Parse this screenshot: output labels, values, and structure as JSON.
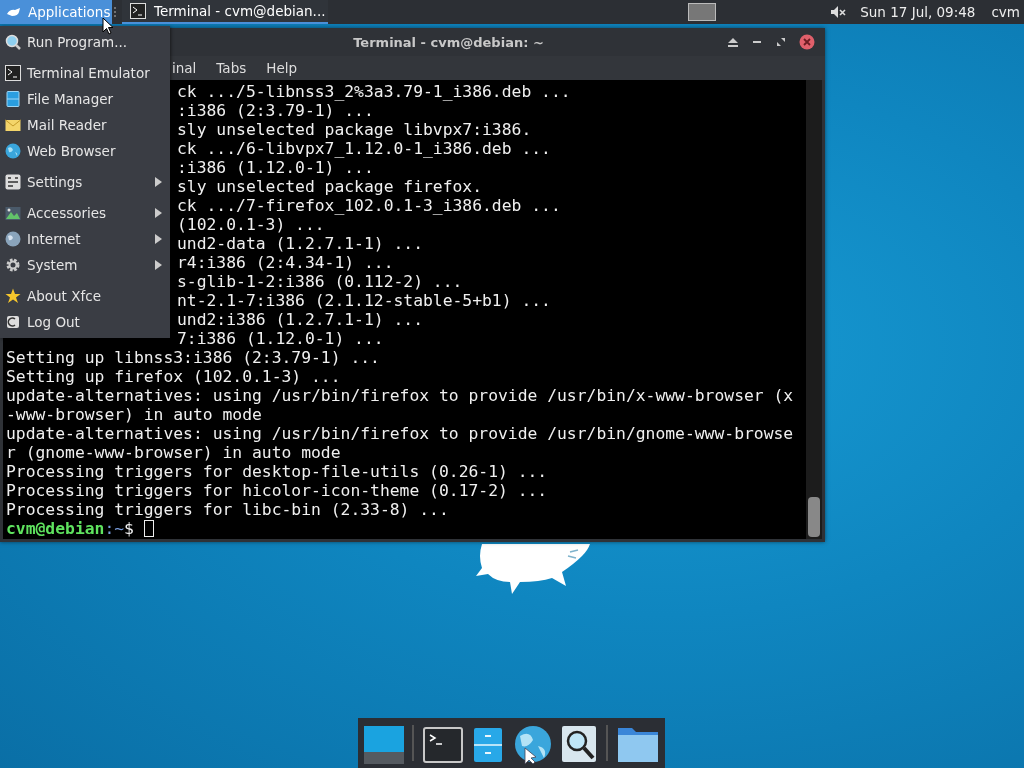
{
  "top_panel": {
    "applications_button": {
      "label": "Applications",
      "selected": true
    },
    "tasks": [
      {
        "title": "Terminal - cvm@debian...",
        "selected": true
      }
    ],
    "muted": true,
    "clock": "Sun 17 Jul, 09:48",
    "user": "cvm"
  },
  "terminal": {
    "title": "Terminal - cvm@debian: ~",
    "menu": [
      "inal",
      "Tabs",
      "Help"
    ],
    "partial_lines": [
      "ck .../5-libnss3_2%3a3.79-1_i386.deb ...",
      ":i386 (2:3.79-1) ...",
      "sly unselected package libvpx7:i386.",
      "ck .../6-libvpx7_1.12.0-1_i386.deb ...",
      ":i386 (1.12.0-1) ...",
      "sly unselected package firefox.",
      "ck .../7-firefox_102.0.1-3_i386.deb ...",
      "(102.0.1-3) ...",
      "und2-data (1.2.7.1-1) ...",
      "r4:i386 (2:4.34-1) ...",
      "s-glib-1-2:i386 (0.112-2) ...",
      "nt-2.1-7:i386 (2.1.12-stable-5+b1) ...",
      "und2:i386 (1.2.7.1-1) ...",
      "7:i386 (1.12.0-1) ..."
    ],
    "lines": [
      "Setting up libnss3:i386 (2:3.79-1) ...",
      "Setting up firefox (102.0.1-3) ...",
      "update-alternatives: using /usr/bin/firefox to provide /usr/bin/x-www-browser (x",
      "-www-browser) in auto mode",
      "update-alternatives: using /usr/bin/firefox to provide /usr/bin/gnome-www-browse",
      "r (gnome-www-browser) in auto mode",
      "Processing triggers for desktop-file-utils (0.26-1) ...",
      "Processing triggers for hicolor-icon-theme (0.17-2) ...",
      "Processing triggers for libc-bin (2.33-8) ..."
    ],
    "prompt": {
      "user_host": "cvm@debian",
      "path": ":~",
      "symbol": "$"
    }
  },
  "app_menu": {
    "items": [
      {
        "kind": "launcher",
        "label": "Run Program..."
      },
      {
        "kind": "separator"
      },
      {
        "kind": "launcher",
        "label": "Terminal Emulator"
      },
      {
        "kind": "launcher",
        "label": "File Manager"
      },
      {
        "kind": "launcher",
        "label": "Mail Reader"
      },
      {
        "kind": "launcher",
        "label": "Web Browser"
      },
      {
        "kind": "separator"
      },
      {
        "kind": "submenu",
        "label": "Settings"
      },
      {
        "kind": "separator"
      },
      {
        "kind": "submenu",
        "label": "Accessories"
      },
      {
        "kind": "submenu",
        "label": "Internet"
      },
      {
        "kind": "submenu",
        "label": "System"
      },
      {
        "kind": "separator"
      },
      {
        "kind": "launcher",
        "label": "About Xfce"
      },
      {
        "kind": "launcher",
        "label": "Log Out"
      }
    ]
  }
}
